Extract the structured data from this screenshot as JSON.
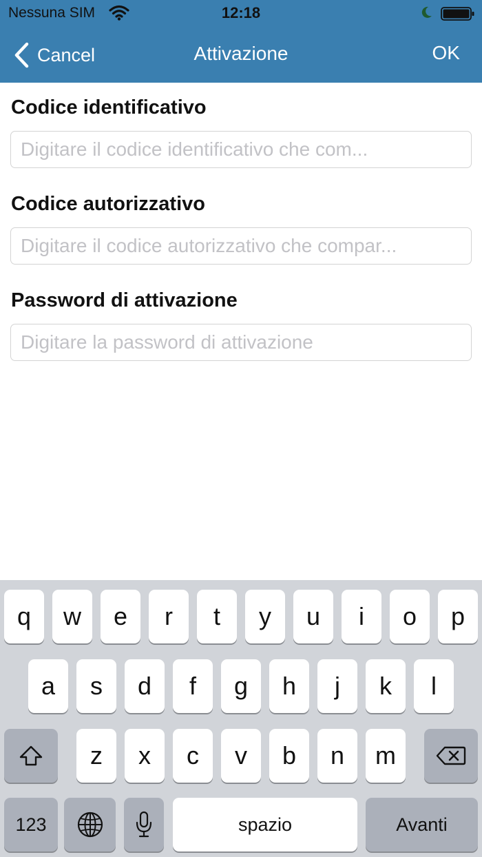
{
  "status_bar": {
    "carrier": "Nessuna SIM",
    "time": "12:18",
    "icons": [
      "wifi-icon",
      "moon-icon",
      "battery-icon"
    ]
  },
  "nav": {
    "back_label": "Cancel",
    "title": "Attivazione",
    "ok_label": "OK"
  },
  "form": {
    "fields": [
      {
        "label": "Codice identificativo",
        "placeholder": "Digitare il codice identificativo che com...",
        "value": ""
      },
      {
        "label": "Codice autorizzativo",
        "placeholder": "Digitare il codice autorizzativo che compar...",
        "value": ""
      },
      {
        "label": "Password di attivazione",
        "placeholder": "Digitare la password di attivazione",
        "value": ""
      }
    ]
  },
  "keyboard": {
    "row1": [
      "q",
      "w",
      "e",
      "r",
      "t",
      "y",
      "u",
      "i",
      "o",
      "p"
    ],
    "row2": [
      "a",
      "s",
      "d",
      "f",
      "g",
      "h",
      "j",
      "k",
      "l"
    ],
    "row3": [
      "z",
      "x",
      "c",
      "v",
      "b",
      "n",
      "m"
    ],
    "numbers_label": "123",
    "space_label": "spazio",
    "return_label": "Avanti",
    "icons": [
      "shift-icon",
      "backspace-icon",
      "globe-icon",
      "microphone-icon"
    ]
  },
  "colors": {
    "nav_background": "#3a7fb0",
    "keyboard_background": "#d1d4d9",
    "function_key": "#abb0ba"
  }
}
